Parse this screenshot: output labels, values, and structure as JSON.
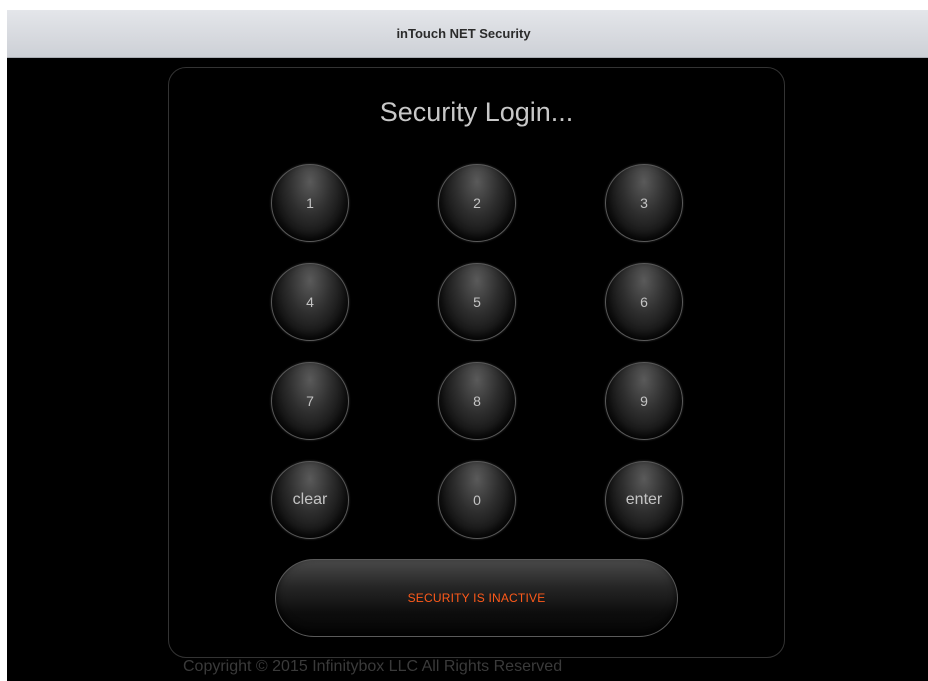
{
  "window": {
    "title": "inTouch NET Security"
  },
  "login": {
    "title": "Security Login...",
    "keypad": [
      {
        "label": "1"
      },
      {
        "label": "2"
      },
      {
        "label": "3"
      },
      {
        "label": "4"
      },
      {
        "label": "5"
      },
      {
        "label": "6"
      },
      {
        "label": "7"
      },
      {
        "label": "8"
      },
      {
        "label": "9"
      },
      {
        "label": "clear"
      },
      {
        "label": "0"
      },
      {
        "label": "enter"
      }
    ],
    "status": "SECURITY IS INACTIVE",
    "status_color": "#ff5a1a"
  },
  "footer": {
    "copyright": "Copyright © 2015 Infinitybox LLC All Rights Reserved"
  }
}
